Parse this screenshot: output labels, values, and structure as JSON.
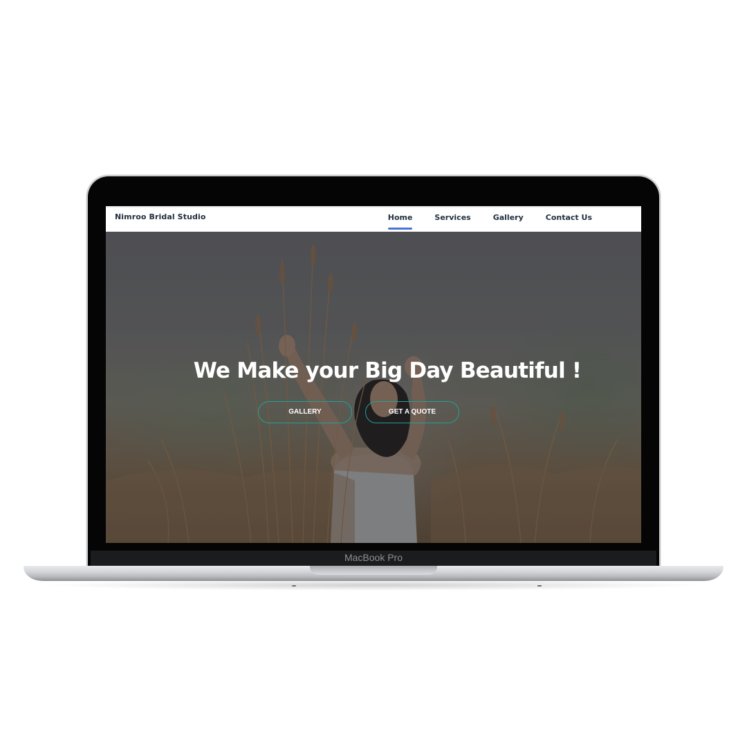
{
  "device": {
    "label": "MacBook Pro"
  },
  "navbar": {
    "brand": "Nimroo Bridal Studio",
    "links": [
      {
        "label": "Home",
        "active": true
      },
      {
        "label": "Services",
        "active": false
      },
      {
        "label": "Gallery",
        "active": false
      },
      {
        "label": "Contact Us",
        "active": false
      }
    ],
    "accent_color": "#4a72d8"
  },
  "hero": {
    "title": "We Make your Big Day Beautiful !",
    "buttons": {
      "gallery": "GALLERY",
      "quote": "GET A QUOTE"
    },
    "button_border_color": "#1fa39a"
  }
}
